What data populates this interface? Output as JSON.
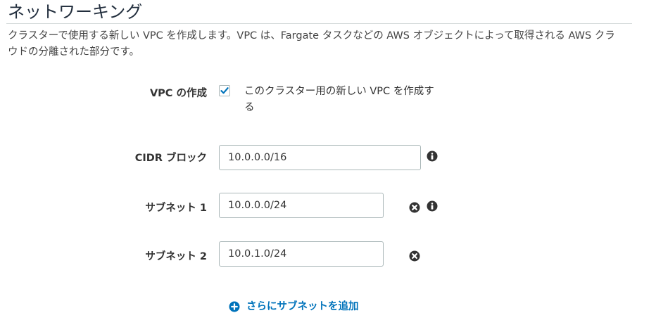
{
  "section": {
    "title": "ネットワーキング",
    "description": "クラスターで使用する新しい VPC を作成します。VPC は、Fargate タスクなどの AWS オブジェクトによって取得される AWS クラウドの分離された部分です。"
  },
  "create_vpc": {
    "label": "VPC の作成",
    "checked": true,
    "checkbox_text": "このクラスター用の新しい VPC を作成する"
  },
  "cidr_block": {
    "label": "CIDR ブロック",
    "value": "10.0.0.0/16"
  },
  "subnets": [
    {
      "label": "サブネット 1",
      "value": "10.0.0.0/24"
    },
    {
      "label": "サブネット 2",
      "value": "10.0.1.0/24"
    }
  ],
  "add_subnet": {
    "label": "さらにサブネットを追加"
  },
  "icons": {
    "checkbox_check": "check-icon",
    "info": "info-icon",
    "remove": "remove-icon",
    "add": "plus-circle-icon"
  },
  "colors": {
    "check": "#0073bb",
    "link": "#0073bb",
    "icon_dark": "#333333",
    "border": "#aab7b8",
    "title": "#232f3e"
  }
}
